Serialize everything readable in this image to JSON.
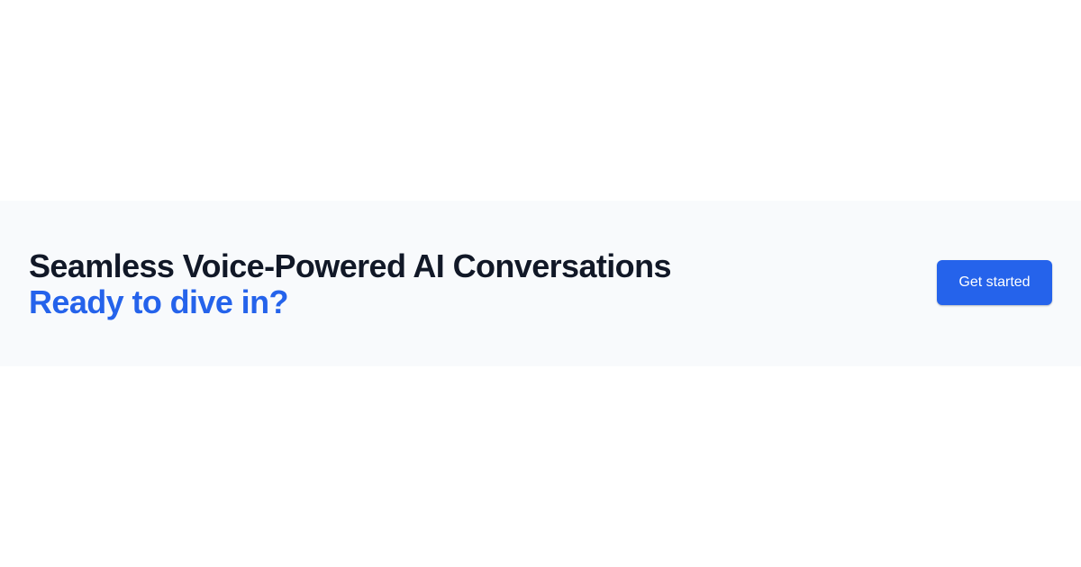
{
  "cta_section": {
    "headline": "Seamless Voice-Powered  AI Conversations",
    "subheadline": "Ready to dive in?",
    "button_label": "Get started"
  },
  "colors": {
    "page_background": "#ffffff",
    "band_background": "#f8fafc",
    "headline_text": "#111827",
    "accent": "#2563eb",
    "button_text": "#ffffff"
  }
}
